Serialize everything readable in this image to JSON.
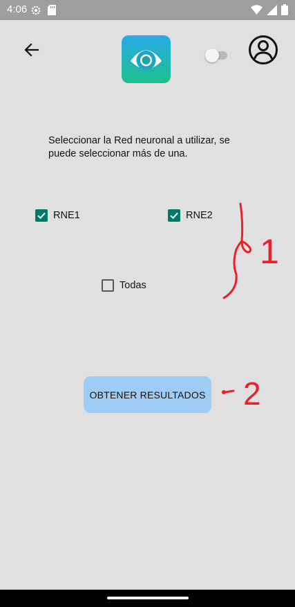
{
  "status_bar": {
    "time": "4:06",
    "icons": [
      "settings-icon",
      "sd-card-icon",
      "wifi-icon",
      "signal-icon",
      "battery-icon"
    ]
  },
  "header": {
    "back_icon": "arrow-left-icon",
    "logo_icon": "eye-icon",
    "toggle_state": "off",
    "profile_icon": "account-circle-icon"
  },
  "main": {
    "instruction": "Seleccionar la Red neuronal a utilizar, se puede seleccionar más de una.",
    "checkboxes": [
      {
        "label": "RNE1",
        "checked": true
      },
      {
        "label": "RNE2",
        "checked": true
      },
      {
        "label": "Todas",
        "checked": false
      }
    ],
    "button_label": "OBTENER RESULTADOS"
  },
  "annotations": {
    "label_1": "1",
    "label_2": "2",
    "color": "#e8202a"
  },
  "colors": {
    "background": "#e0e0e0",
    "status_bar": "#9e9e9e",
    "checkbox_accent": "#00796b",
    "button": "#9dcdf4",
    "logo_gradient_top": "#29a9e6",
    "logo_gradient_bottom": "#1cc08e"
  }
}
